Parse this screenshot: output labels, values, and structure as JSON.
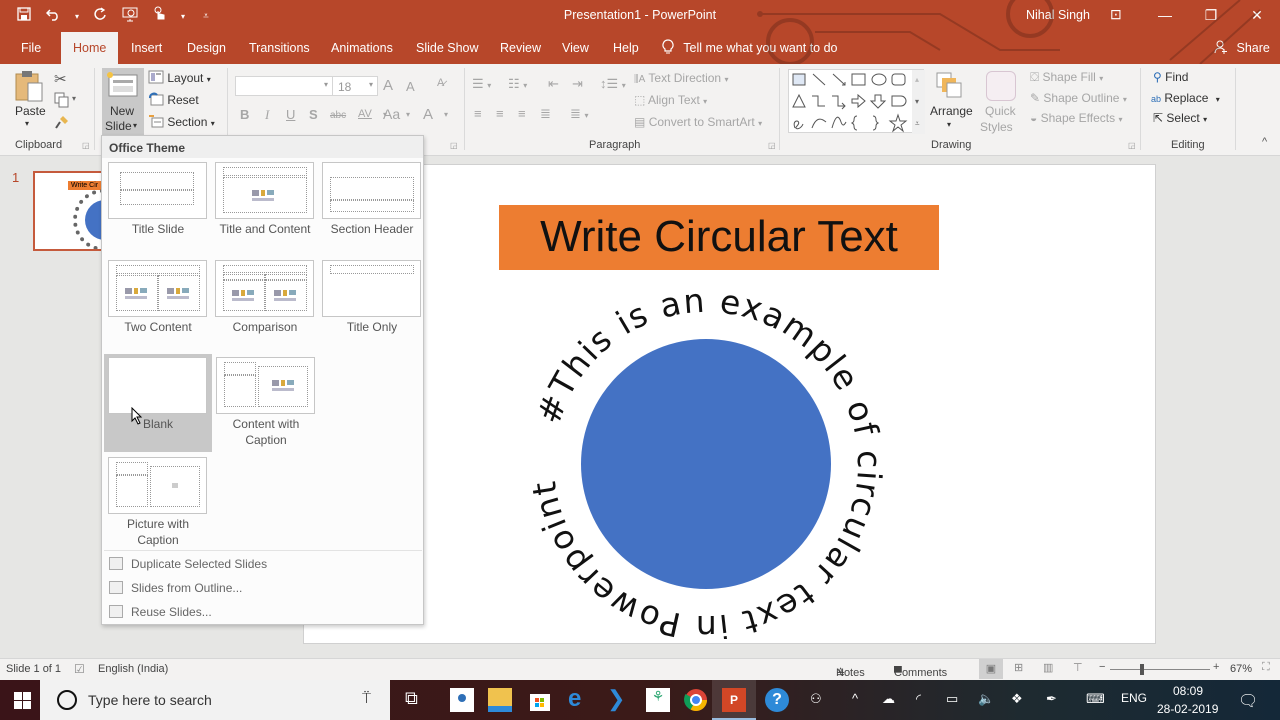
{
  "window": {
    "title": "Presentation1  -  PowerPoint",
    "user": "Nihal Singh",
    "qat": [
      "save-icon",
      "undo-icon",
      "redo-icon",
      "start-from-beginning-icon",
      "touch-mode-icon",
      "customize-qat-icon"
    ],
    "controls": {
      "ribbon_display": "⊡",
      "minimize": "—",
      "restore": "❐",
      "close": "✕"
    }
  },
  "tabs": [
    {
      "label": "File",
      "active": false
    },
    {
      "label": "Home",
      "active": true
    },
    {
      "label": "Insert",
      "active": false
    },
    {
      "label": "Design",
      "active": false
    },
    {
      "label": "Transitions",
      "active": false
    },
    {
      "label": "Animations",
      "active": false
    },
    {
      "label": "Slide Show",
      "active": false
    },
    {
      "label": "Review",
      "active": false
    },
    {
      "label": "View",
      "active": false
    },
    {
      "label": "Help",
      "active": false
    }
  ],
  "tell_me": "Tell me what you want to do",
  "share": "Share",
  "ribbon": {
    "clipboard": {
      "label": "Clipboard",
      "paste": "Paste"
    },
    "slides": {
      "new_slide_1": "New",
      "new_slide_2": "Slide",
      "layout": "Layout",
      "reset": "Reset",
      "section": "Section"
    },
    "font": {
      "font_name": "",
      "font_size": "18",
      "bold": "B",
      "italic": "I",
      "underline": "U",
      "shadow": "S",
      "strike": "abc",
      "spacing": "AV",
      "case": "Aa",
      "color": "A",
      "grow": "A",
      "shrink": "A"
    },
    "paragraph": {
      "label": "Paragraph",
      "text_direction": "Text Direction",
      "align_text": "Align Text",
      "convert_smartart": "Convert to SmartArt"
    },
    "drawing": {
      "label": "Drawing",
      "arrange": "Arrange",
      "quick_styles_1": "Quick",
      "quick_styles_2": "Styles",
      "shape_fill": "Shape Fill",
      "shape_outline": "Shape Outline",
      "shape_effects": "Shape Effects"
    },
    "editing": {
      "label": "Editing",
      "find": "Find",
      "replace": "Replace",
      "select": "Select"
    }
  },
  "thumbnails": [
    {
      "number": "1",
      "title": "Write Cir"
    }
  ],
  "gallery": {
    "header": "Office Theme",
    "layouts": [
      {
        "label": "Title Slide"
      },
      {
        "label": "Title and Content"
      },
      {
        "label": "Section Header"
      },
      {
        "label": "Two Content"
      },
      {
        "label": "Comparison"
      },
      {
        "label": "Title Only"
      },
      {
        "label": "Blank",
        "hovered": true
      },
      {
        "label": "Content with Caption"
      },
      {
        "label": "Picture with Caption"
      }
    ],
    "menu": [
      {
        "label": "Duplicate Selected Slides"
      },
      {
        "label": "Slides from Outline..."
      },
      {
        "label": "Reuse Slides..."
      }
    ]
  },
  "slide": {
    "title": "Write Circular Text",
    "title_bg": "#ed7d31",
    "circle_color": "#4472c4",
    "circular_text": "#This is an example of circular text in Powerpoint"
  },
  "status": {
    "slide_info": "Slide 1 of 1",
    "language": "English (India)",
    "notes": "Notes",
    "comments": "Comments",
    "zoom": "67%",
    "zoom_value": 67
  },
  "taskbar": {
    "search_placeholder": "Type here to search",
    "lang": "ENG",
    "time": "08:09",
    "date": "28-02-2019"
  }
}
